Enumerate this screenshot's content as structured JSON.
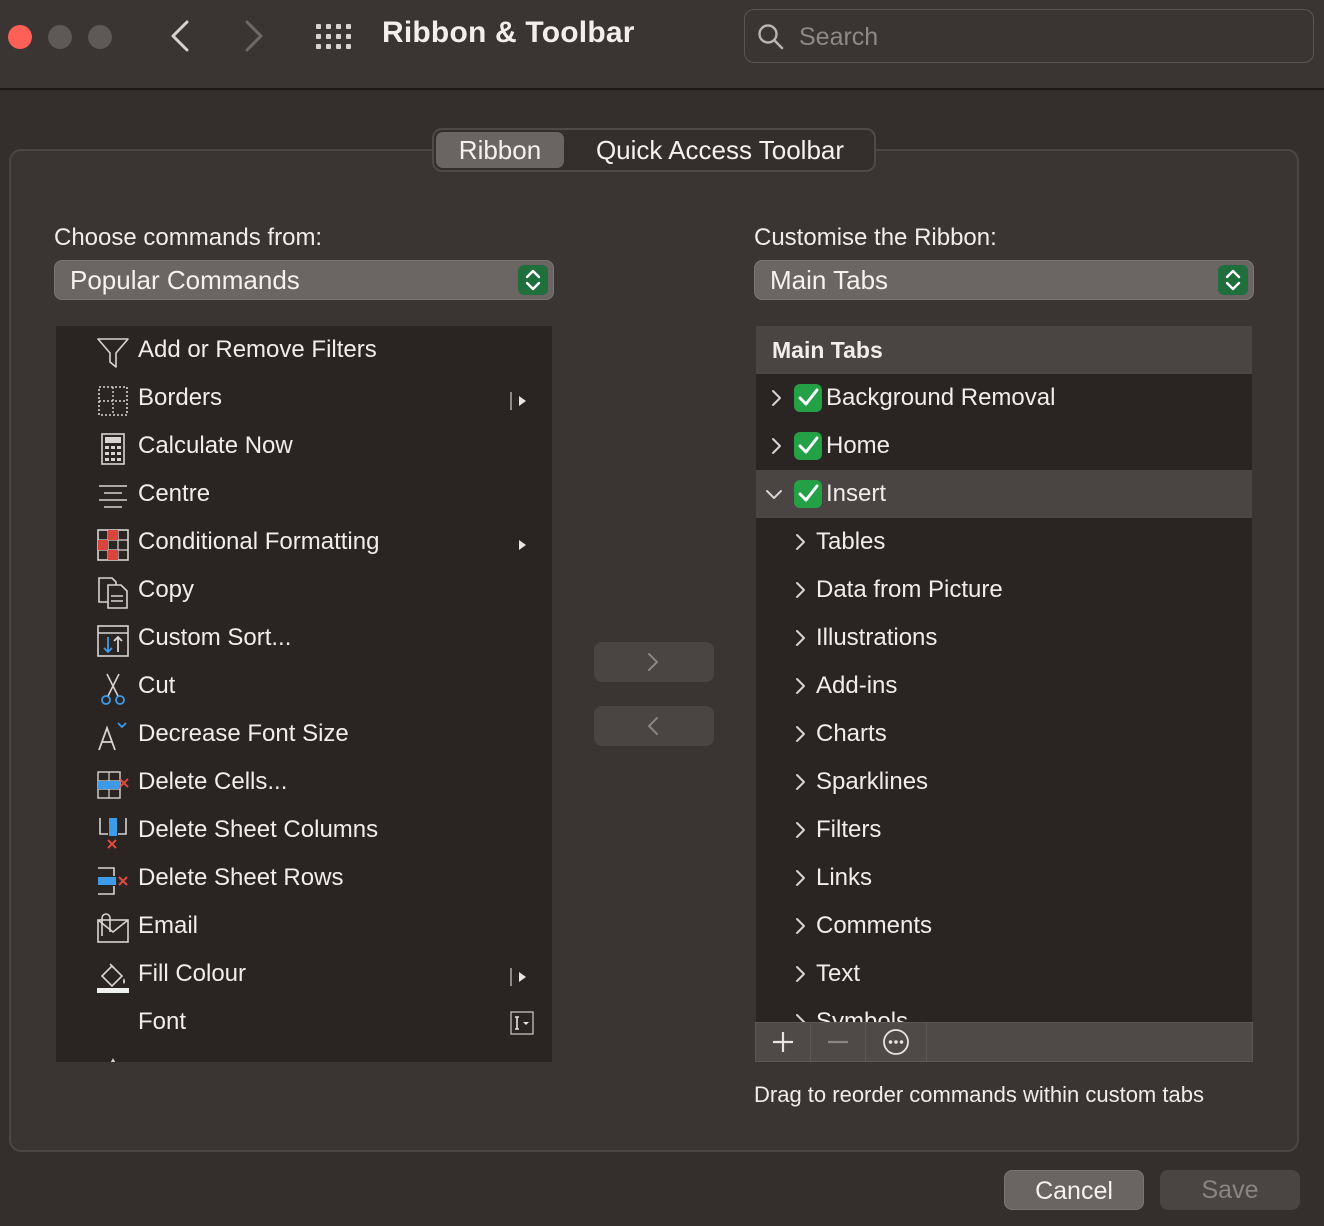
{
  "window": {
    "title": "Ribbon & Toolbar",
    "search_placeholder": "Search"
  },
  "tabs": [
    {
      "label": "Ribbon",
      "selected": true
    },
    {
      "label": "Quick Access Toolbar",
      "selected": false
    }
  ],
  "left": {
    "label": "Choose commands from:",
    "popup_value": "Popular Commands",
    "commands": [
      {
        "label": "Add or Remove Filters",
        "icon": "filter-icon"
      },
      {
        "label": "Borders",
        "icon": "borders-icon",
        "submenu": true
      },
      {
        "label": "Calculate Now",
        "icon": "calculator-icon"
      },
      {
        "label": "Centre",
        "icon": "align-center-icon"
      },
      {
        "label": "Conditional Formatting",
        "icon": "conditional-formatting-icon",
        "submenu": true
      },
      {
        "label": "Copy",
        "icon": "copy-icon"
      },
      {
        "label": "Custom Sort...",
        "icon": "custom-sort-icon"
      },
      {
        "label": "Cut",
        "icon": "scissors-icon"
      },
      {
        "label": "Decrease Font Size",
        "icon": "decrease-font-icon"
      },
      {
        "label": "Delete Cells...",
        "icon": "delete-cells-icon"
      },
      {
        "label": "Delete Sheet Columns",
        "icon": "delete-columns-icon"
      },
      {
        "label": "Delete Sheet Rows",
        "icon": "delete-rows-icon"
      },
      {
        "label": "Email",
        "icon": "email-icon"
      },
      {
        "label": "Fill Colour",
        "icon": "fill-colour-icon",
        "submenu": true
      },
      {
        "label": "Font",
        "icon": "",
        "font_box": true
      }
    ]
  },
  "right": {
    "label": "Customise the Ribbon:",
    "popup_value": "Main Tabs",
    "header": "Main Tabs",
    "tabs": [
      {
        "label": "Background Removal",
        "checked": true
      },
      {
        "label": "Home",
        "checked": true
      },
      {
        "label": "Insert",
        "checked": true,
        "expanded": true,
        "selected": true
      }
    ],
    "groups": [
      "Tables",
      "Data from Picture",
      "Illustrations",
      "Add-ins",
      "Charts",
      "Sparklines",
      "Filters",
      "Links",
      "Comments",
      "Text",
      "Symbols"
    ]
  },
  "hint": "Drag to reorder commands within custom tabs",
  "buttons": {
    "cancel": "Cancel",
    "save": "Save"
  },
  "colors": {
    "accent_green": "#24a047",
    "close_red": "#fe5f57"
  }
}
